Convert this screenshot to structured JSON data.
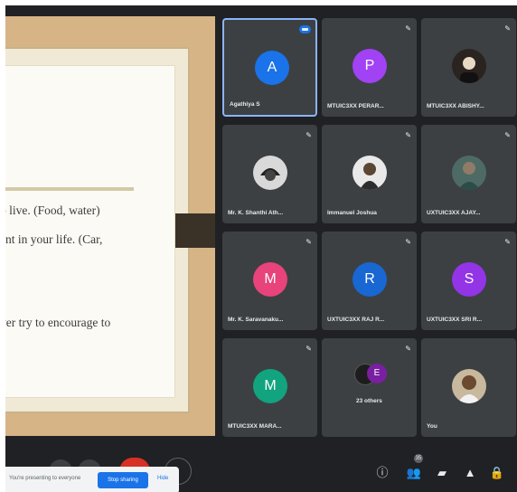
{
  "slide": {
    "line1": "o live. (Food, water)",
    "line2": "ent in your life. (Car,",
    "line3": "ver try to encourage to"
  },
  "participants": [
    {
      "name": "Agathiya S",
      "initial": "A",
      "color": "#1a73e8",
      "speaking": true
    },
    {
      "name": "MTUIC3XX PERAR...",
      "initial": "P",
      "color": "#a142f4",
      "speaking": false
    },
    {
      "name": "MTUIC3XX ABISHY...",
      "initial": "",
      "color": "",
      "speaking": false
    },
    {
      "name": "Mr. K. Shanthi Ath...",
      "initial": "",
      "color": "",
      "speaking": false
    },
    {
      "name": "Immanuel Joshua",
      "initial": "",
      "color": "",
      "speaking": false
    },
    {
      "name": "UXTUIC3XX AJAY...",
      "initial": "",
      "color": "",
      "speaking": false
    },
    {
      "name": "Mr. K. Saravanaku...",
      "initial": "M",
      "color": "#e8437b",
      "speaking": false
    },
    {
      "name": "UXTUIC3XX RAJ R...",
      "initial": "R",
      "color": "#1967d2",
      "speaking": false
    },
    {
      "name": "UXTUIC3XX SRI R...",
      "initial": "S",
      "color": "#9334e6",
      "speaking": false
    },
    {
      "name": "MTUIC3XX MARA...",
      "initial": "M",
      "color": "#12a37f",
      "speaking": false
    },
    {
      "name": "23 others",
      "initial": "",
      "color": "",
      "speaking": false
    },
    {
      "name": "You",
      "initial": "",
      "color": "",
      "speaking": false
    }
  ],
  "mic_icon": "mic-off-icon",
  "bottom_bar": {
    "sharing_text": "You're presenting to everyone",
    "stop_label": "Stop sharing",
    "hide_label": "Hide",
    "people_count": "35",
    "icons": [
      "info-icon",
      "people-icon",
      "chat-icon",
      "activities-icon",
      "lock-icon"
    ]
  }
}
